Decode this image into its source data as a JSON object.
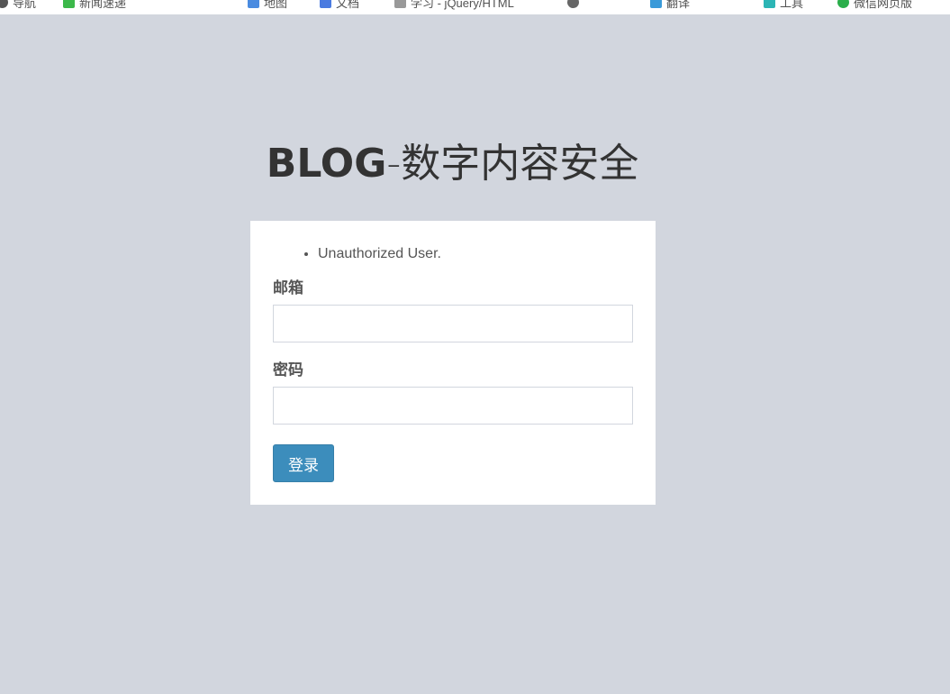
{
  "bookmarks": [
    {
      "icon": "globe-icon",
      "color": "#555555",
      "round": true,
      "label": "导航"
    },
    {
      "icon": "bookmark-icon",
      "color": "#3cb84a",
      "round": false,
      "label": "新闻速递"
    },
    {
      "icon": "person-icon",
      "color": "#4a8be0",
      "round": false,
      "label": "地图"
    },
    {
      "icon": "doc-icon",
      "color": "#4a7be0",
      "round": false,
      "label": "文档"
    },
    {
      "icon": "folder-icon",
      "color": "#999999",
      "round": false,
      "label": "学习 - jQuery/HTML"
    },
    {
      "icon": "clock-icon",
      "color": "#666666",
      "round": true,
      "label": ""
    },
    {
      "icon": "plane-icon",
      "color": "#3a9ad9",
      "round": false,
      "label": "翻译"
    },
    {
      "icon": "tool-icon",
      "color": "#2cb5b5",
      "round": false,
      "label": "工具"
    },
    {
      "icon": "chat-icon",
      "color": "#2aae4a",
      "round": true,
      "label": "微信网页版"
    }
  ],
  "logo": {
    "bold": "BLOG",
    "rest": "-数字内容安全"
  },
  "errors": [
    "Unauthorized User."
  ],
  "form": {
    "email_label": "邮箱",
    "email_value": "",
    "password_label": "密码",
    "password_value": "",
    "submit_label": "登录"
  },
  "colors": {
    "page_bg": "#d2d6de",
    "button": "#3c8dbc"
  }
}
